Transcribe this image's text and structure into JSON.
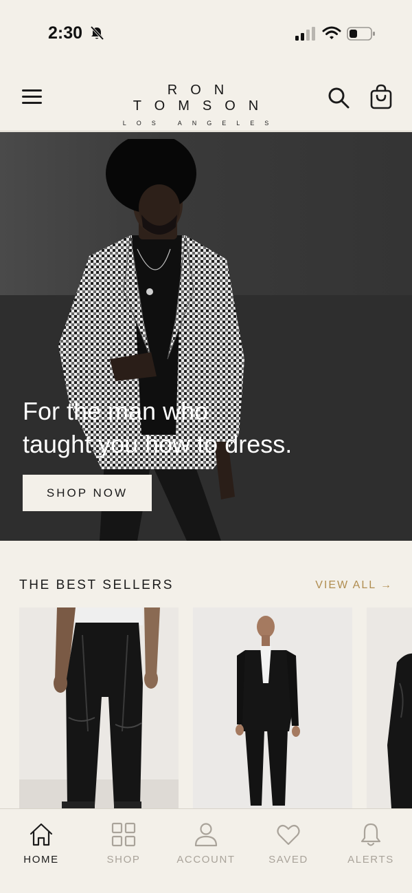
{
  "status_bar": {
    "time": "2:30",
    "icons": [
      "bell-slash-icon",
      "cellular-signal-icon",
      "wifi-icon",
      "battery-icon"
    ]
  },
  "header": {
    "brand_name": "RON TOMSON",
    "brand_sub": "LOS ANGELES",
    "icons": [
      "menu-icon",
      "search-icon",
      "shopping-bag-icon"
    ]
  },
  "hero": {
    "headline_line1": "For the man who",
    "headline_line2": "taught you how to dress.",
    "cta_label": "SHOP NOW"
  },
  "best_sellers": {
    "title": "THE BEST SELLERS",
    "view_all_label": "VIEW ALL →"
  },
  "bottom_nav": {
    "items": [
      {
        "label": "HOME",
        "icon": "home-icon",
        "active": true
      },
      {
        "label": "SHOP",
        "icon": "grid-icon",
        "active": false
      },
      {
        "label": "ACCOUNT",
        "icon": "user-icon",
        "active": false
      },
      {
        "label": "SAVED",
        "icon": "heart-icon",
        "active": false
      },
      {
        "label": "ALERTS",
        "icon": "bell-icon",
        "active": false
      }
    ]
  },
  "colors": {
    "background": "#f3f0e9",
    "accent_gold": "#b08d50",
    "text_dark": "#1a1a1a",
    "nav_inactive": "#a9a39a"
  }
}
